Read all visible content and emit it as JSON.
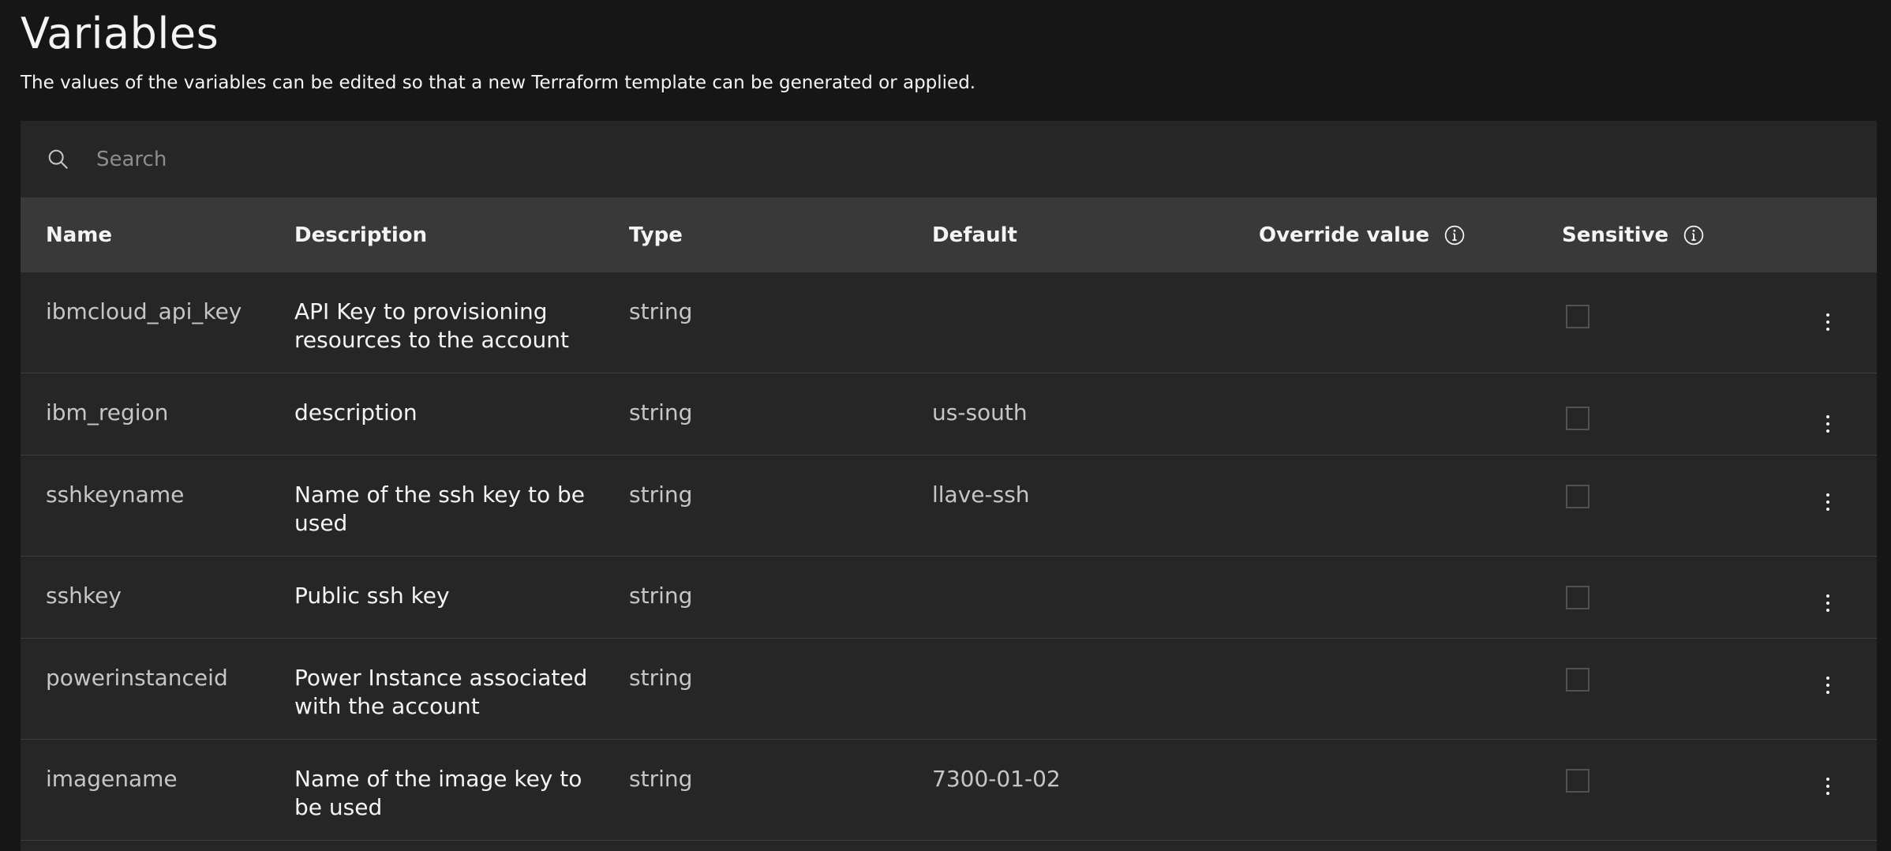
{
  "header": {
    "title": "Variables",
    "subtitle": "The values of the variables can be edited so that a new Terraform template can be generated or applied."
  },
  "search": {
    "placeholder": "Search",
    "icon": "search-icon"
  },
  "table": {
    "columns": {
      "name": "Name",
      "description": "Description",
      "type": "Type",
      "default": "Default",
      "override": "Override value",
      "sensitive": "Sensitive"
    },
    "rows": [
      {
        "name": "ibmcloud_api_key",
        "description": "API Key to provisioning resources to the account",
        "type": "string",
        "default": ""
      },
      {
        "name": "ibm_region",
        "description": "description",
        "type": "string",
        "default": "us-south"
      },
      {
        "name": "sshkeyname",
        "description": "Name of the ssh key to be used",
        "type": "string",
        "default": "llave-ssh"
      },
      {
        "name": "sshkey",
        "description": "Public ssh key",
        "type": "string",
        "default": ""
      },
      {
        "name": "powerinstanceid",
        "description": "Power Instance associated with the account",
        "type": "string",
        "default": ""
      },
      {
        "name": "imagename",
        "description": "Name of the image key to be used",
        "type": "string",
        "default": "7300-01-02"
      }
    ]
  },
  "colors": {
    "background": "#161616",
    "panel": "#262626",
    "header_row": "#393939",
    "text": "#f4f4f4",
    "muted_text": "#c6c6c6"
  }
}
